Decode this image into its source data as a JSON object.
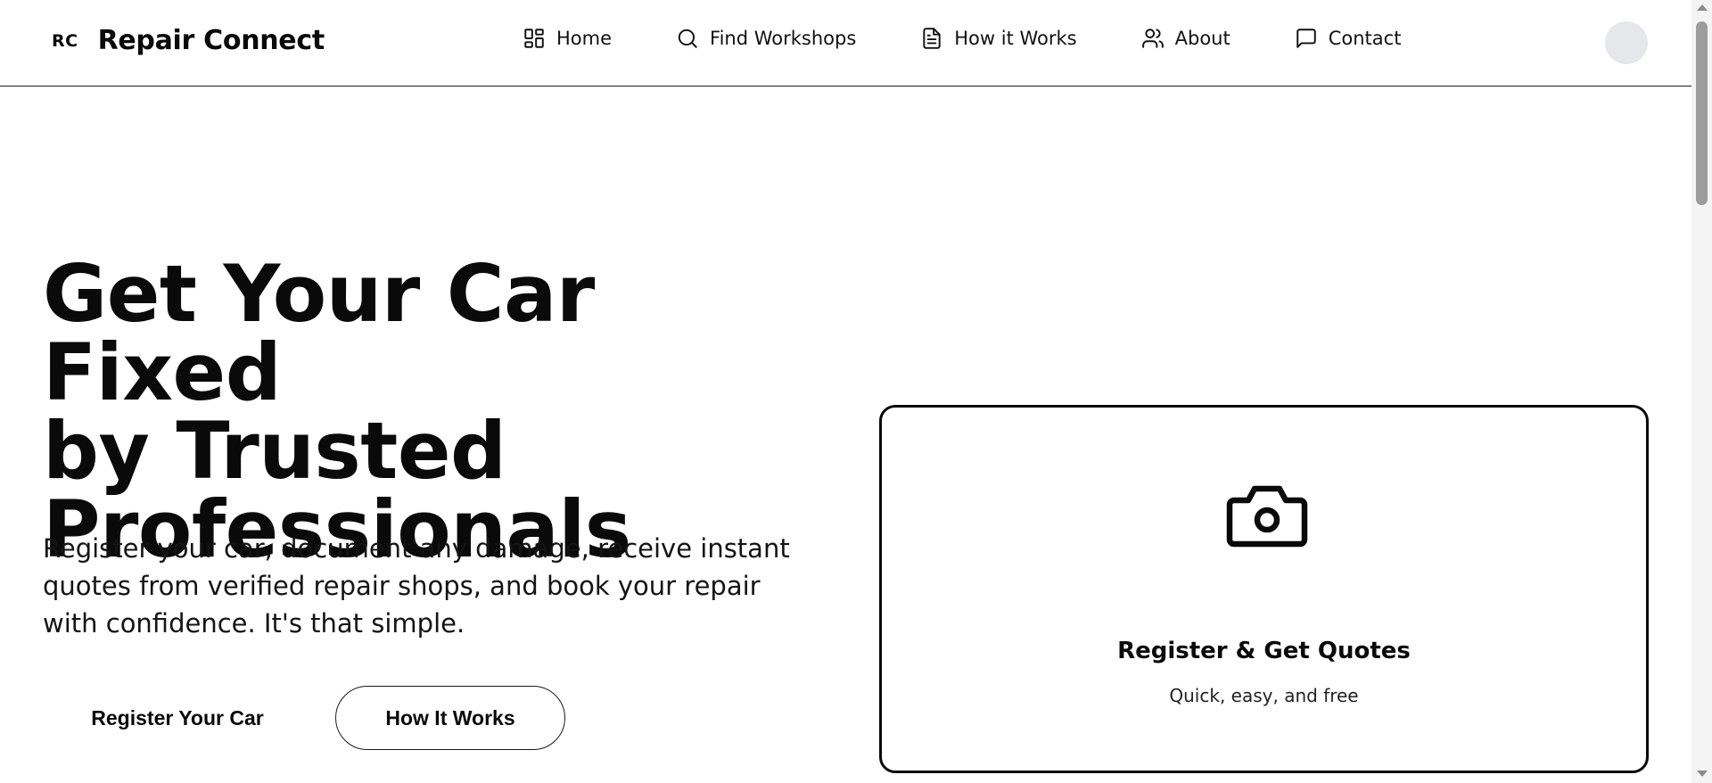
{
  "brand": {
    "mark": "RC",
    "name": "Repair Connect"
  },
  "nav": {
    "items": [
      {
        "label": "Home",
        "icon": "grid-icon"
      },
      {
        "label": "Find Workshops",
        "icon": "search-icon"
      },
      {
        "label": "How it Works",
        "icon": "document-icon"
      },
      {
        "label": "About",
        "icon": "users-icon"
      },
      {
        "label": "Contact",
        "icon": "message-icon"
      }
    ]
  },
  "hero": {
    "title_lines": [
      "Get Your Car Fixed",
      "by Trusted",
      "Professionals"
    ],
    "subtitle": "Register your car, document any damage, receive instant quotes from verified repair shops, and book your repair with confidence. It's that simple.",
    "primary_button": "Register Your Car",
    "secondary_button": "How It Works"
  },
  "card": {
    "icon": "camera-icon",
    "title": "Register & Get Quotes",
    "subtitle": "Quick, easy, and free"
  },
  "colors": {
    "text": "#0a0a0a",
    "border": "#1a1a1a",
    "avatar_bg": "#e5e7eb",
    "background": "#ffffff"
  }
}
